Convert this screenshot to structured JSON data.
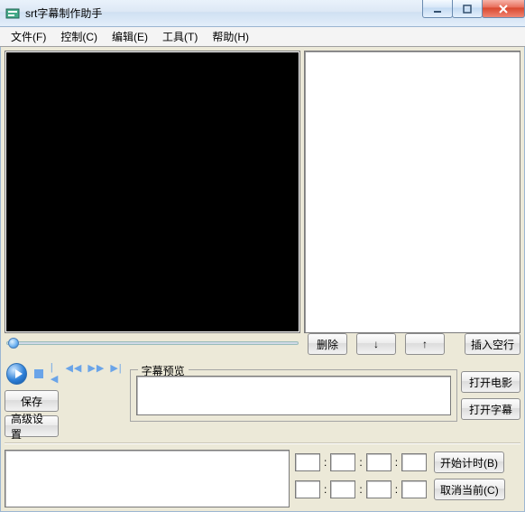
{
  "window": {
    "title": "srt字幕制作助手"
  },
  "menu": {
    "file": "文件(F)",
    "control": "控制(C)",
    "edit": "编辑(E)",
    "tool": "工具(T)",
    "help": "帮助(H)"
  },
  "list_buttons": {
    "delete": "删除",
    "down": "↓",
    "up": "↑",
    "insert_blank": "插入空行"
  },
  "transport_icons": {
    "prev": "|◀",
    "rew": "◀◀",
    "fwd": "▶▶",
    "next": "▶|"
  },
  "buttons": {
    "save": "保存",
    "adv_settings": "高级设置",
    "open_movie": "打开电影",
    "open_subtitle": "打开字幕",
    "start_timer": "开始计时(B)",
    "cancel_cur": "取消当前(C)"
  },
  "preview": {
    "legend": "字幕预览",
    "text": ""
  },
  "timecode": {
    "start": {
      "h": "",
      "m": "",
      "s": "",
      "ms": ""
    },
    "end": {
      "h": "",
      "m": "",
      "s": "",
      "ms": ""
    }
  },
  "subtitle_text": "",
  "subtitle_list": []
}
